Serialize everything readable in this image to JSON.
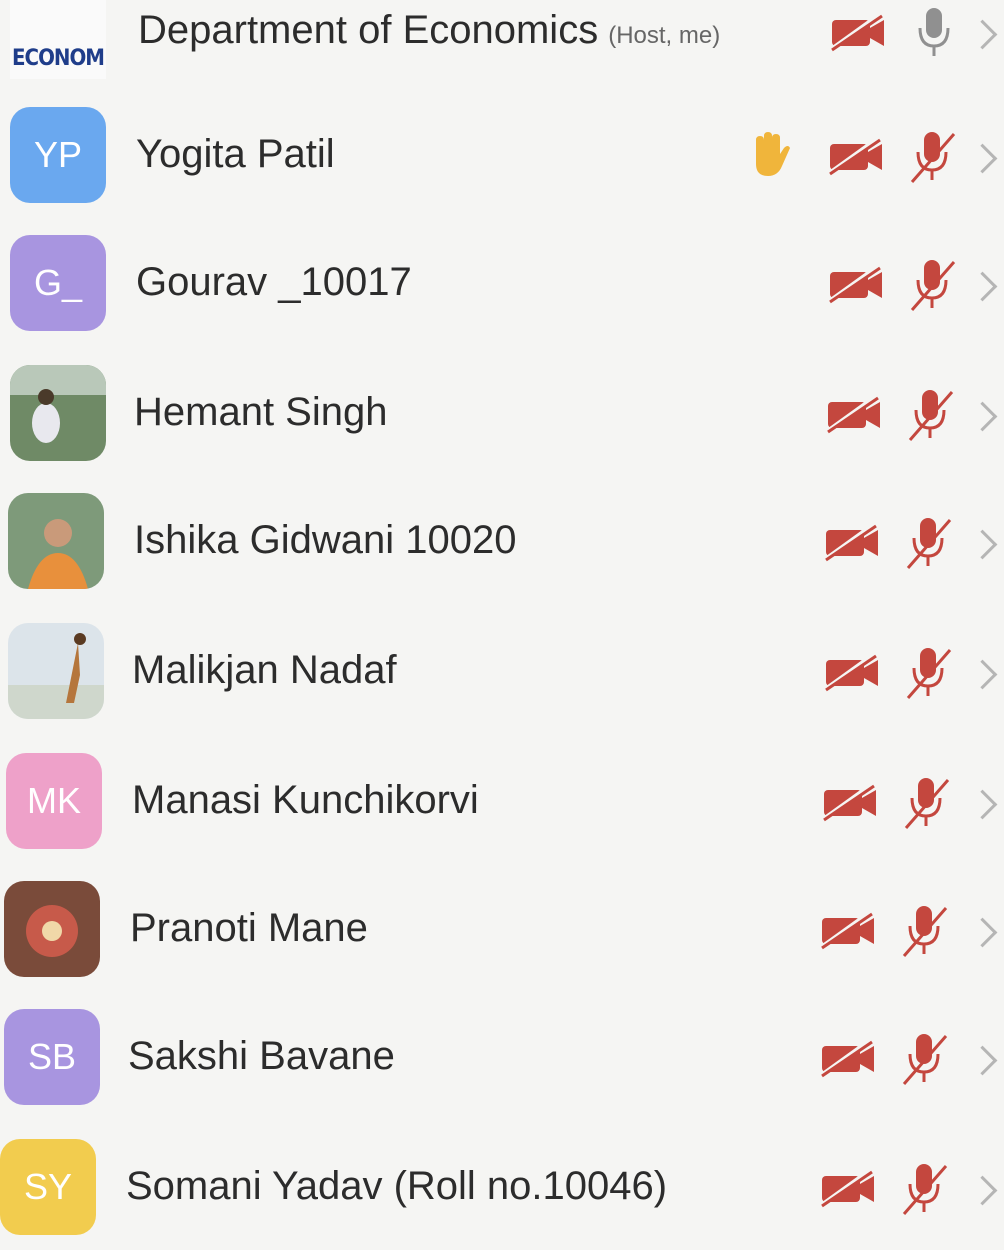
{
  "participants": [
    {
      "name": "Department of Economics",
      "tag": "(Host, me)",
      "avatar": {
        "kind": "logo",
        "text": "ECONOM"
      },
      "hand_raised": false,
      "video_on": false,
      "audio_muted": false
    },
    {
      "name": "Yogita Patil",
      "tag": "",
      "avatar": {
        "kind": "initials",
        "text": "YP",
        "color": "#6aa8ef"
      },
      "hand_raised": true,
      "video_on": false,
      "audio_muted": true
    },
    {
      "name": "Gourav _10017",
      "tag": "",
      "avatar": {
        "kind": "initials",
        "text": "G_",
        "color": "#a895e0"
      },
      "hand_raised": false,
      "video_on": false,
      "audio_muted": true
    },
    {
      "name": "Hemant Singh",
      "tag": "",
      "avatar": {
        "kind": "photo",
        "scene": "field"
      },
      "hand_raised": false,
      "video_on": false,
      "audio_muted": true
    },
    {
      "name": "Ishika Gidwani 10020",
      "tag": "",
      "avatar": {
        "kind": "photo",
        "scene": "portrait"
      },
      "hand_raised": false,
      "video_on": false,
      "audio_muted": true
    },
    {
      "name": "Malikjan Nadaf",
      "tag": "",
      "avatar": {
        "kind": "photo",
        "scene": "beach"
      },
      "hand_raised": false,
      "video_on": false,
      "audio_muted": true
    },
    {
      "name": "Manasi Kunchikorvi",
      "tag": "",
      "avatar": {
        "kind": "initials",
        "text": "MK",
        "color": "#eea1c9"
      },
      "hand_raised": false,
      "video_on": false,
      "audio_muted": true
    },
    {
      "name": "Pranoti Mane",
      "tag": "",
      "avatar": {
        "kind": "photo",
        "scene": "flower"
      },
      "hand_raised": false,
      "video_on": false,
      "audio_muted": true
    },
    {
      "name": "Sakshi Bavane",
      "tag": "",
      "avatar": {
        "kind": "initials",
        "text": "SB",
        "color": "#a895e0"
      },
      "hand_raised": false,
      "video_on": false,
      "audio_muted": true
    },
    {
      "name": "Somani Yadav (Roll no.10046)",
      "tag": "",
      "avatar": {
        "kind": "initials",
        "text": "SY",
        "color": "#f2cc4e"
      },
      "hand_raised": false,
      "video_on": false,
      "audio_muted": true
    }
  ],
  "colors": {
    "muted_red": "#c4473e",
    "hand_yellow": "#f0b53b",
    "chevron_gray": "#b5b5b5",
    "mic_gray": "#909090"
  }
}
